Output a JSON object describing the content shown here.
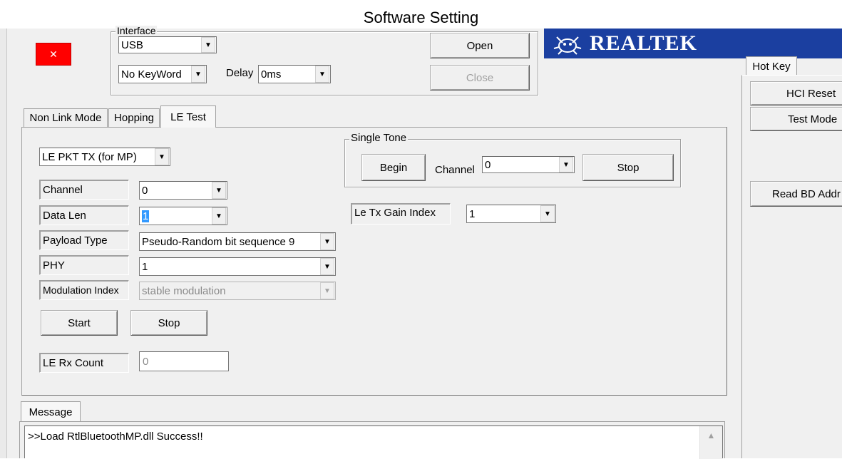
{
  "caption": "Software Setting",
  "connection": {
    "interface_legend": "Interface",
    "interface_value": "USB",
    "keyword_value": "No KeyWord",
    "delay_label": "Delay",
    "delay_value": "0ms",
    "open_label": "Open",
    "close_label": "Close"
  },
  "brand": {
    "logo_text": "REALTEK",
    "color": "#1b3fa0"
  },
  "status_indicator_color": "#ff0000",
  "tabs": [
    {
      "label": "Non Link Mode"
    },
    {
      "label": "Hopping"
    },
    {
      "label": "LE Test"
    }
  ],
  "le_test": {
    "mode_value": "LE PKT TX (for MP)",
    "channel_label": "Channel",
    "channel_value": "0",
    "data_len_label": "Data Len",
    "data_len_value": "1",
    "payload_label": "Payload Type",
    "payload_value": "Pseudo-Random bit sequence 9",
    "phy_label": "PHY",
    "phy_value": "1",
    "mod_label": "Modulation Index",
    "mod_value": "stable modulation",
    "start_label": "Start",
    "stop_label": "Stop",
    "rx_count_label": "LE Rx Count",
    "rx_count_value": "0"
  },
  "single_tone": {
    "legend": "Single Tone",
    "begin_label": "Begin",
    "channel_label": "Channel",
    "channel_value": "0",
    "stop_label": "Stop"
  },
  "gain": {
    "label": "Le Tx Gain Index",
    "value": "1"
  },
  "hotkey": {
    "tab_label": "Hot Key",
    "hci_reset": "HCI Reset",
    "test_mode": "Test Mode",
    "read_bd_addr": "Read BD Addr"
  },
  "message": {
    "tab_label": "Message",
    "text": ">>Load RtlBluetoothMP.dll Success!!"
  }
}
